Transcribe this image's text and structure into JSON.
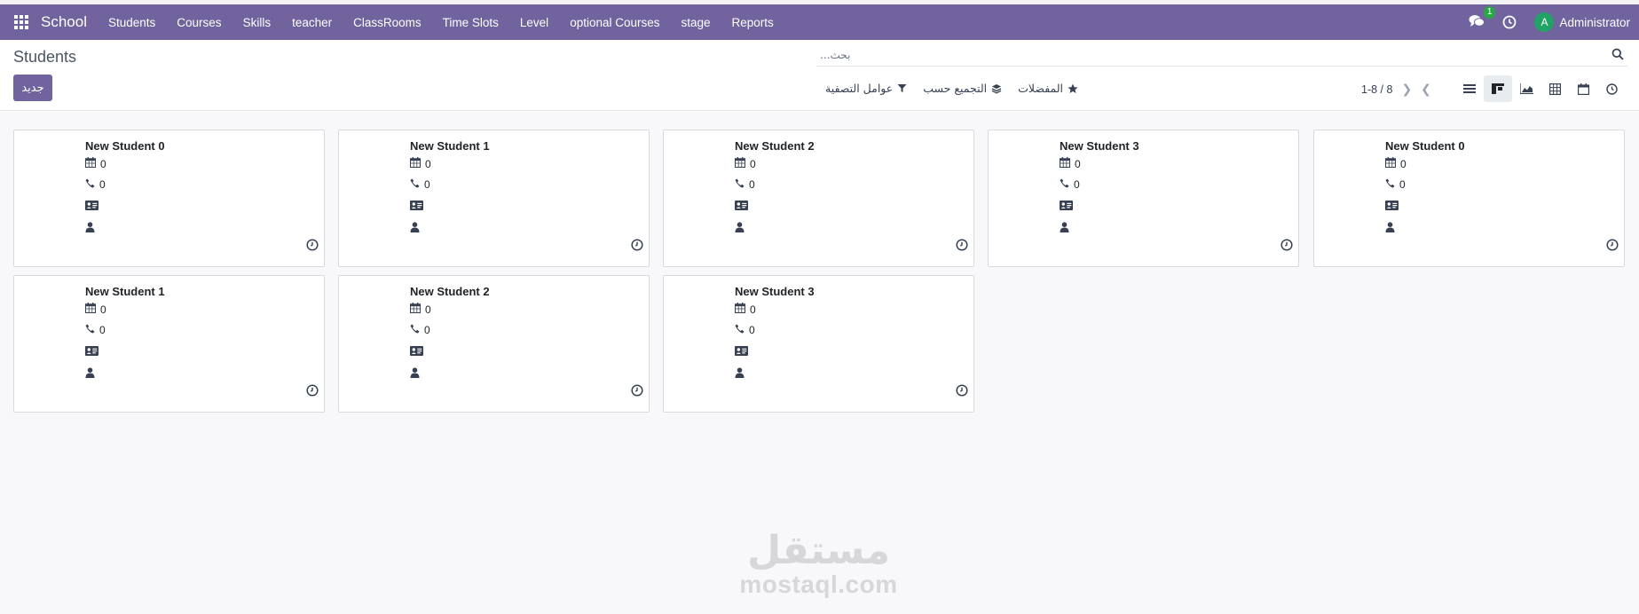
{
  "navbar": {
    "app_name": "School",
    "menu": [
      "Students",
      "Courses",
      "Skills",
      "teacher",
      "ClassRooms",
      "Time Slots",
      "Level",
      "optional Courses",
      "stage",
      "Reports"
    ],
    "messages_count": "1",
    "user_initial": "A",
    "user_name": "Administrator"
  },
  "control": {
    "title": "Students",
    "new_label": "جديد",
    "search_placeholder": "بحث...",
    "filters_label": "عوامل التصفية",
    "groupby_label": "التجميع حسب",
    "favorites_label": "المفضلات",
    "pager": "1-8 / 8"
  },
  "students": [
    {
      "name": "New Student 0",
      "date": "0",
      "phone": "0"
    },
    {
      "name": "New Student 1",
      "date": "0",
      "phone": "0"
    },
    {
      "name": "New Student 2",
      "date": "0",
      "phone": "0"
    },
    {
      "name": "New Student 3",
      "date": "0",
      "phone": "0"
    },
    {
      "name": "New Student 0",
      "date": "0",
      "phone": "0"
    },
    {
      "name": "New Student 1",
      "date": "0",
      "phone": "0"
    },
    {
      "name": "New Student 2",
      "date": "0",
      "phone": "0"
    },
    {
      "name": "New Student 3",
      "date": "0",
      "phone": "0"
    }
  ],
  "watermark": {
    "arabic": "مستقل",
    "latin": "mostaql.com"
  },
  "colors": {
    "brand": "#71639e",
    "badge": "#28a745",
    "avatar": "#21a366"
  }
}
